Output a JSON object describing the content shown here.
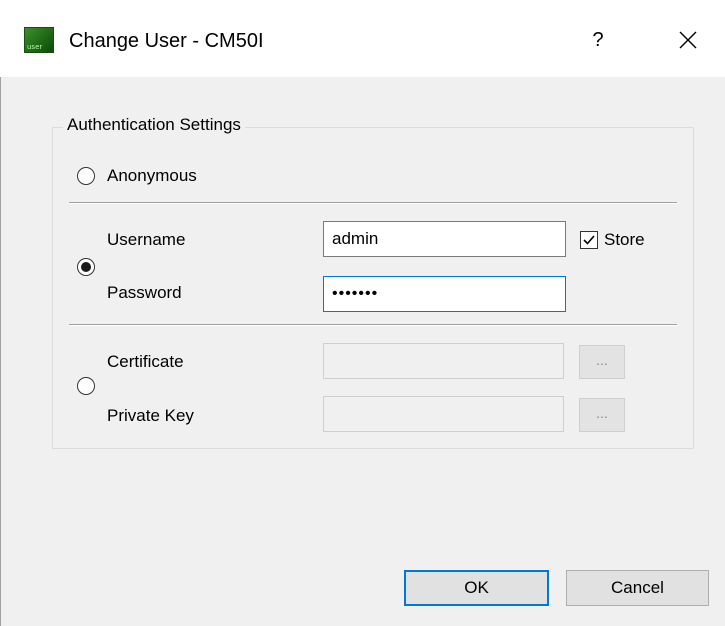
{
  "window": {
    "title": "Change User - CM50I",
    "icon": "app-icon",
    "icon_label": "user",
    "help_label": "?",
    "close_icon": "close-icon"
  },
  "auth": {
    "group_title": "Authentication Settings",
    "selected_mode": "username",
    "anonymous_label": "Anonymous",
    "username_label": "Username",
    "username_value": "admin",
    "password_label": "Password",
    "password_value": "•••••••",
    "store_label": "Store",
    "store_checked": true,
    "certificate_label": "Certificate",
    "certificate_value": "",
    "private_key_label": "Private Key",
    "private_key_value": "",
    "browse_label": "..."
  },
  "buttons": {
    "ok_label": "OK",
    "cancel_label": "Cancel"
  },
  "colors": {
    "focus_accent": "#0078d7",
    "window_bg": "#f0f0f0",
    "icon_green": "#2e7d1f"
  }
}
